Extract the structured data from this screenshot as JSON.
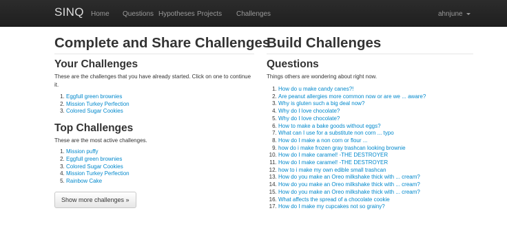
{
  "nav": {
    "brand": "SINQ",
    "items": [
      "Home",
      "Questions",
      "Hypotheses",
      "Projects",
      "Challenges"
    ],
    "user": "ahnjune"
  },
  "left": {
    "heading": "Complete and Share Challenges",
    "your": {
      "title": "Your Challenges",
      "desc": "These are the challenges that you have already started. Click on one to continue it.",
      "items": [
        "Eggfull green brownies",
        "Mission Turkey Perfection",
        "Colored Sugar Cookies"
      ]
    },
    "top": {
      "title": "Top Challenges",
      "desc": "These are the most active challenges.",
      "items": [
        "Mission puffy",
        "Eggfull green brownies",
        "Colored Sugar Cookies",
        "Mission Turkey Perfection",
        "Rainbow Cake"
      ],
      "button": "Show more challenges »"
    }
  },
  "right": {
    "heading": "Build Challenges",
    "questions": {
      "title": "Questions",
      "desc": "Things others are wondering about right now.",
      "items": [
        "How do u make candy canes?!",
        "Are peanut allergies more common now or are we ... aware?",
        "Why is gluten such a big deal now?",
        "Why do I love chocolate?",
        "Why do I love chocolate?",
        "How to make a bake goods without eggs?",
        "What can I use for a substitute non corn ... typo",
        "How do I make a non corn or flour ...",
        "how do i make frozen gray trashcan looking brownie",
        "How do I make caramel! -THE DESTROYER",
        "How do I make caramel! -THE DESTROYER",
        "how to i make my own edible small trashcan",
        "How do you make an Oreo milkshake thick with ... cream?",
        "How do you make an Oreo milkshake thick with ... cream?",
        "How do you make an Oreo milkshake thick with ... cream?",
        "What affects the spread of a chocolate cookie",
        "How do I make my cupcakes not so grainy?"
      ]
    }
  }
}
